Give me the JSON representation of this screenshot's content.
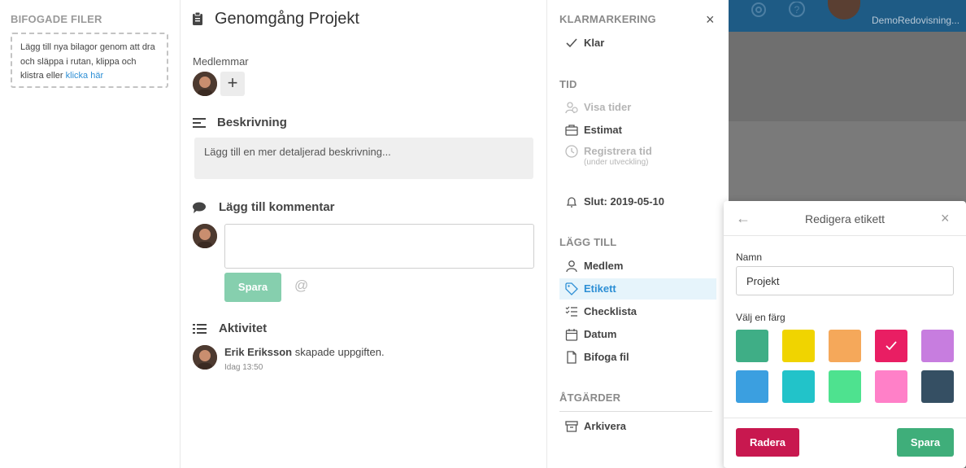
{
  "attachments": {
    "title": "BIFOGADE FILER",
    "drop_text": "Lägg till nya bilagor genom att dra och släppa i rutan, klippa och klistra eller",
    "drop_link": "klicka här"
  },
  "card": {
    "title": "Genomgång Projekt",
    "members_label": "Medlemmar",
    "add_member": "+",
    "description_heading": "Beskrivning",
    "description_placeholder": "Lägg till en mer detaljerad beskrivning...",
    "comment_heading": "Lägg till kommentar",
    "comment_save": "Spara",
    "mention_symbol": "@",
    "activity_heading": "Aktivitet",
    "activity": [
      {
        "user": "Erik Eriksson",
        "action": "skapade uppgiften.",
        "time": "Idag 13:50"
      }
    ]
  },
  "sidebar": {
    "close": "×",
    "sections": {
      "klar": "KLARMARKERING",
      "tid": "TID",
      "lagg_till": "LÄGG TILL",
      "atgarder": "ÅTGÄRDER"
    },
    "items": {
      "klar": "Klar",
      "visa_tider": "Visa tider",
      "estimat": "Estimat",
      "registrera_tid": "Registrera tid",
      "registrera_sub": "(under utveckling)",
      "slut": "Slut: 2019-05-10",
      "medlem": "Medlem",
      "etikett": "Etikett",
      "checklista": "Checklista",
      "datum": "Datum",
      "bifoga_fil": "Bifoga fil",
      "arkivera": "Arkivera"
    }
  },
  "background_app": {
    "user_name": "DemoRedovisning..."
  },
  "label_editor": {
    "back": "←",
    "title": "Redigera etikett",
    "close": "×",
    "name_label": "Namn",
    "name_value": "Projekt",
    "color_label": "Välj en färg",
    "colors": [
      "#3fae86",
      "#f0d400",
      "#f5a85a",
      "#e91e63",
      "#c77ddf",
      "#3b9fe0",
      "#22c3c9",
      "#4ee28f",
      "#ff80c8",
      "#354f63"
    ],
    "selected_color": "#e91e63",
    "delete_button": "Radera",
    "save_button": "Spara"
  }
}
